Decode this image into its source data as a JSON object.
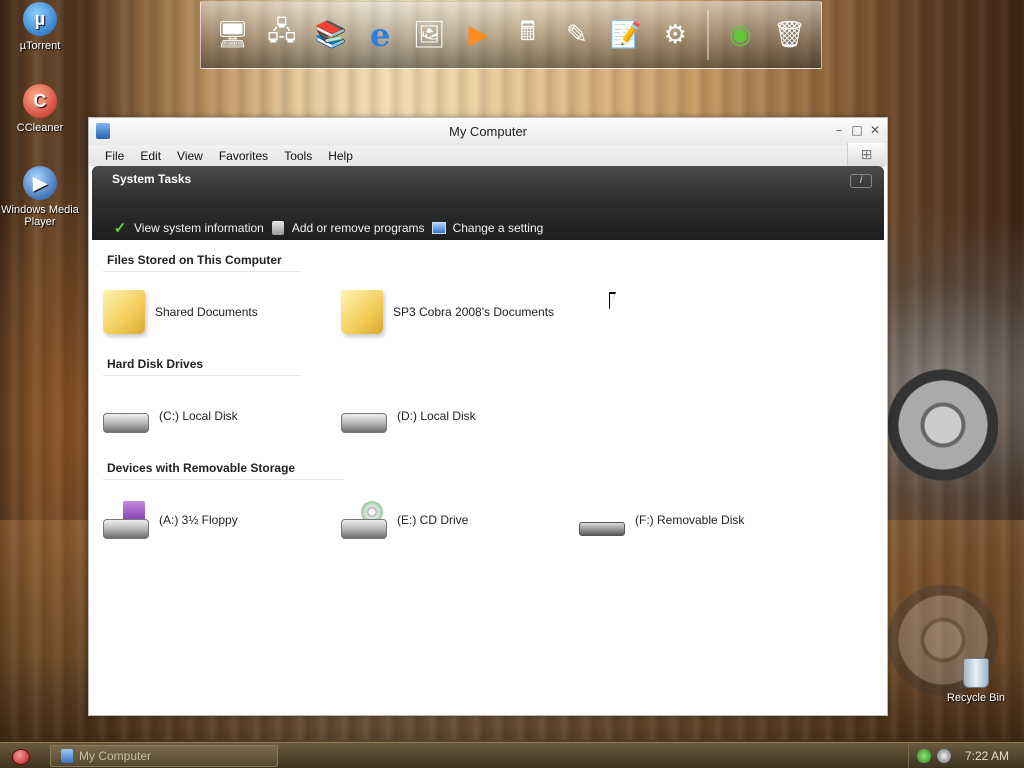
{
  "desktop": {
    "icons": [
      {
        "label": "µTorrent",
        "glyph": "µ"
      },
      {
        "label": "CCleaner",
        "glyph": "C"
      },
      {
        "label": "Windows Media Player",
        "glyph": "▶"
      },
      {
        "label": "Recycle Bin"
      }
    ]
  },
  "dock": {
    "items": [
      {
        "name": "my-computer-icon",
        "glyph": "🖥"
      },
      {
        "name": "network-icon",
        "glyph": "🖧"
      },
      {
        "name": "documents-icon",
        "glyph": "📚"
      },
      {
        "name": "internet-explorer-icon",
        "glyph": "e"
      },
      {
        "name": "display-settings-icon",
        "glyph": "🖼"
      },
      {
        "name": "media-player-icon",
        "glyph": "▶"
      },
      {
        "name": "calculator-icon",
        "glyph": "🖩"
      },
      {
        "name": "paint-icon",
        "glyph": "✎"
      },
      {
        "name": "notepad-icon",
        "glyph": "📝"
      },
      {
        "name": "control-panel-icon",
        "glyph": "⚙"
      },
      {
        "name": "windows-logo-icon",
        "glyph": "◉"
      },
      {
        "name": "recycle-bin-icon",
        "glyph": "🗑"
      }
    ]
  },
  "window": {
    "title": "My Computer",
    "menu": [
      "File",
      "Edit",
      "View",
      "Favorites",
      "Tools",
      "Help"
    ],
    "tasks": {
      "heading": "System Tasks",
      "links": [
        "View system information",
        "Add or remove programs",
        "Change a setting"
      ]
    },
    "groups": {
      "files": {
        "title": "Files Stored on This Computer",
        "items": [
          "Shared Documents",
          "SP3 Cobra 2008's Documents"
        ]
      },
      "hdd": {
        "title": "Hard Disk Drives",
        "items": [
          "(C:) Local Disk",
          "(D:) Local Disk"
        ]
      },
      "removable": {
        "title": "Devices with Removable Storage",
        "items": [
          "(A:) 3½ Floppy",
          "(E:) CD Drive",
          "(F:) Removable Disk"
        ]
      }
    }
  },
  "taskbar": {
    "task_label": "My Computer",
    "clock": "7:22 AM"
  }
}
